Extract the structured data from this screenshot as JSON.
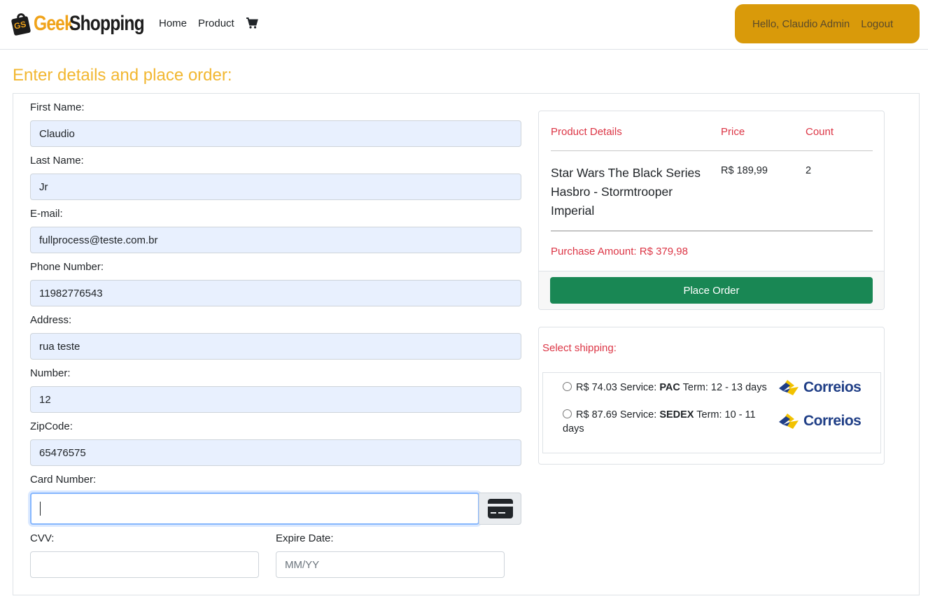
{
  "navbar": {
    "brand_primary": "Geek",
    "brand_secondary": "Shopping",
    "brand_badge": "GS",
    "links": [
      "Home",
      "Product"
    ],
    "cart_icon": "shopping-cart-icon",
    "greeting": "Hello, Claudio Admin",
    "logout": "Logout"
  },
  "page": {
    "title": "Enter details and place order:"
  },
  "form": {
    "first_name": {
      "label": "First Name:",
      "value": "Claudio"
    },
    "last_name": {
      "label": "Last Name:",
      "value": "Jr"
    },
    "email": {
      "label": "E-mail:",
      "value": "fullprocess@teste.com.br"
    },
    "phone": {
      "label": "Phone Number:",
      "value": "11982776543"
    },
    "address": {
      "label": "Address:",
      "value": "rua teste"
    },
    "number": {
      "label": "Number:",
      "value": "12"
    },
    "zipcode": {
      "label": "ZipCode:",
      "value": "65476575"
    },
    "card_number": {
      "label": "Card Number:",
      "value": "",
      "icon": "credit-card-icon"
    },
    "cvv": {
      "label": "CVV:",
      "value": ""
    },
    "expire": {
      "label": "Expire Date:",
      "placeholder": "MM/YY"
    }
  },
  "summary": {
    "headers": {
      "product": "Product Details",
      "price": "Price",
      "count": "Count"
    },
    "items": [
      {
        "name": "Star Wars The Black Series Hasbro - Stormtrooper Imperial",
        "price": "R$ 189,99",
        "count": "2"
      }
    ],
    "purchase_amount": "Purchase Amount: R$ 379,98",
    "place_order": "Place Order"
  },
  "shipping": {
    "title": "Select shipping:",
    "options": [
      {
        "price": "R$ 74.03",
        "service_label": "Service:",
        "service": "PAC",
        "term_label": "Term:",
        "term": "12 - 13 days",
        "carrier": "Correios"
      },
      {
        "price": "R$ 87.69",
        "service_label": "Service:",
        "service": "SEDEX",
        "term_label": "Term:",
        "term": "10 - 11 days",
        "carrier": "Correios"
      }
    ]
  },
  "colors": {
    "accent": "#f2b731",
    "user_box": "#d99a0a",
    "danger_text": "#dc3545",
    "success_button": "#198754",
    "autofill_bg": "#e8f0fe"
  }
}
